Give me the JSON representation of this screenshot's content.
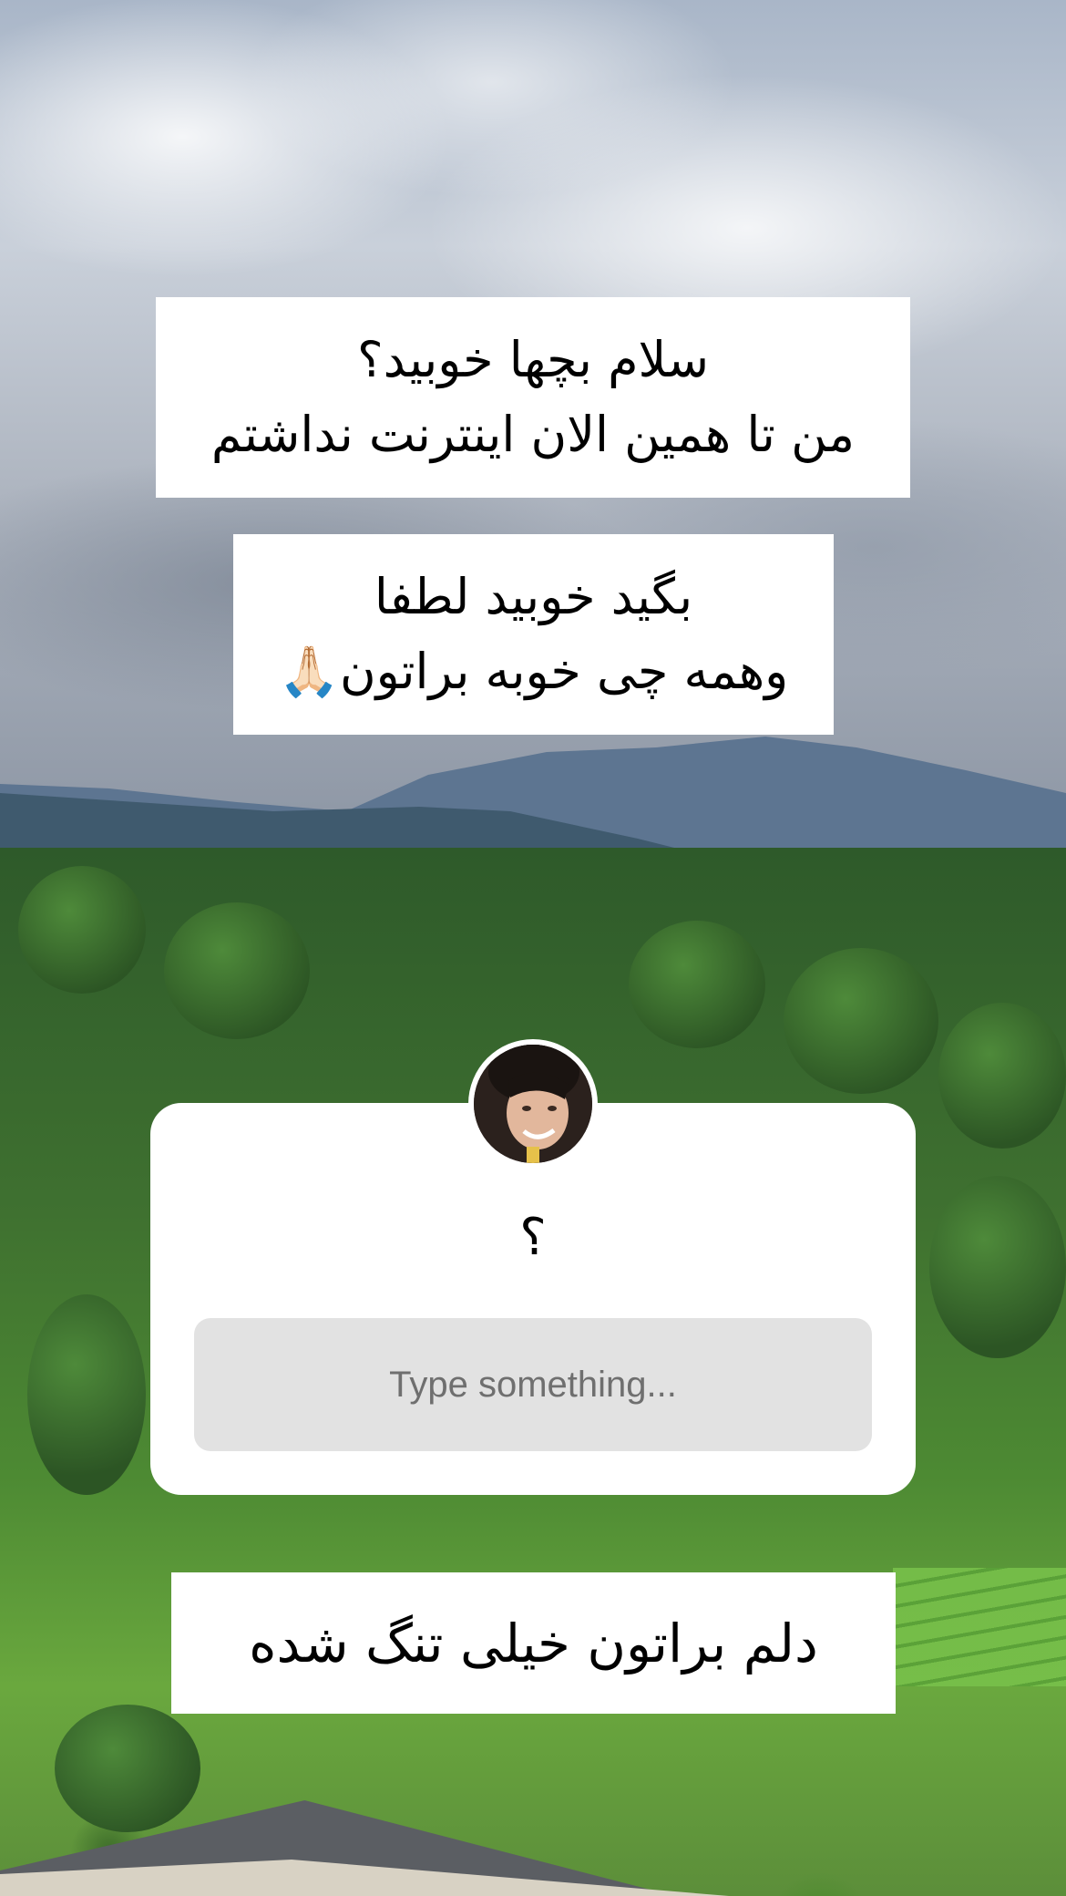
{
  "story_text": {
    "box1": {
      "line1": "سلام بچها خوبید؟",
      "line2": "من تا همین الان اینترنت نداشتم"
    },
    "box2": {
      "line1": "بگید خوبید لطفا",
      "line2": "وهمه چی خوبه براتون🙏🏻"
    },
    "box3": {
      "line1": "دلم براتون خیلی تنگ شده"
    }
  },
  "question_sticker": {
    "question": "؟",
    "answer_placeholder": "Type something..."
  },
  "icons": {
    "avatar": "profile-avatar"
  }
}
